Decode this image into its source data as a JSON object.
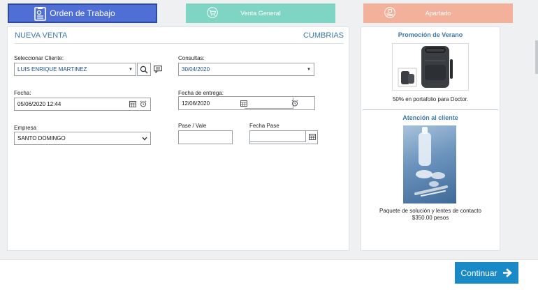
{
  "tabs": [
    {
      "label": "Orden de Trabajo",
      "icon": "clipboard-icon",
      "color": "#4f6fd6"
    },
    {
      "label": "Venta General",
      "icon": "cart-icon",
      "color": "#7fd5c4"
    },
    {
      "label": "Apartado",
      "icon": "hand-box-icon",
      "color": "#f3b09a"
    }
  ],
  "form": {
    "title": "NUEVA VENTA",
    "brand": "CUMBRIAS",
    "client_label": "Seleccionar Cliente:",
    "client_value": "LUIS ENRIQUE MARTINEZ",
    "consultas_label": "Consultas:",
    "consultas_value": "30/04/2020",
    "fecha_label": "Fecha:",
    "fecha_value": "05/06/2020 12:44",
    "entrega_label": "Fecha de entrega:",
    "entrega_value": "12/06/2020",
    "empresa_label": "Empresa",
    "empresa_value": "SANTO DOMINGO",
    "pase_label": "Pase / Vale",
    "pase_value": "",
    "fecha_pase_label": "Fecha Pase",
    "fecha_pase_value": ""
  },
  "side": {
    "promo_title": "Promoción de Verano",
    "promo_caption": "50% en portafolio para Doctor.",
    "care_title": "Atención al cliente",
    "care_caption_1": "Paquete de solución y lentes de contacto",
    "care_caption_2": "$350.00 pesos"
  },
  "footer": {
    "continue_label": "Continuar"
  },
  "colors": {
    "accent": "#3c79ad",
    "primary_button": "#1a8ac6"
  }
}
